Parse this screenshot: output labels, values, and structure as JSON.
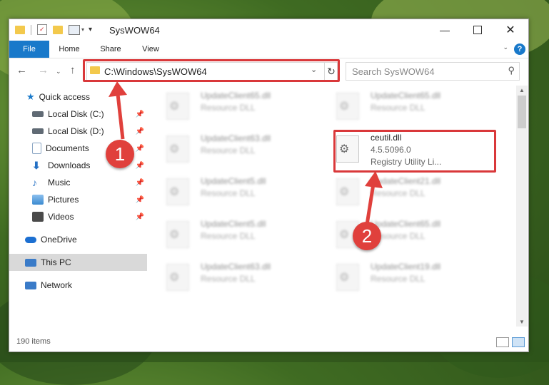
{
  "window": {
    "title": "SysWOW64"
  },
  "ribbon": {
    "tabs": [
      "File",
      "Home",
      "Share",
      "View"
    ],
    "help": "?"
  },
  "address": {
    "path": "C:\\Windows\\SysWOW64"
  },
  "search": {
    "placeholder": "Search SysWOW64"
  },
  "sidebar": {
    "items": [
      {
        "label": "Quick access",
        "icon": "star-icon",
        "color": "#1979ca"
      },
      {
        "label": "Local Disk (C:)",
        "icon": "drive-icon",
        "color": "#606a74",
        "pinned": true
      },
      {
        "label": "Local Disk (D:)",
        "icon": "drive-icon",
        "color": "#606a74",
        "pinned": true
      },
      {
        "label": "Documents",
        "icon": "document-icon",
        "color": "#8ba6c4",
        "pinned": true
      },
      {
        "label": "Downloads",
        "icon": "download-icon",
        "color": "#2470c4",
        "pinned": true
      },
      {
        "label": "Music",
        "icon": "music-icon",
        "color": "#2470c4",
        "pinned": true
      },
      {
        "label": "Pictures",
        "icon": "pictures-icon",
        "color": "#3b8ad0",
        "pinned": true
      },
      {
        "label": "Videos",
        "icon": "video-icon",
        "color": "#4a4a4a",
        "pinned": true
      },
      {
        "label": "OneDrive",
        "icon": "cloud-icon",
        "color": "#1c6fd1"
      },
      {
        "label": "This PC",
        "icon": "computer-icon",
        "color": "#3a7bc8",
        "selected": true
      },
      {
        "label": "Network",
        "icon": "network-icon",
        "color": "#3a7bc8"
      }
    ]
  },
  "files": [
    {
      "name": "UpdateClient65.dll",
      "sub": "Resource DLL",
      "blurred": true
    },
    {
      "name": "UpdateClient65.dll",
      "sub": "Resource DLL",
      "blurred": true
    },
    {
      "name": "UpdateClient63.dll",
      "sub": "Resource DLL",
      "blurred": true
    },
    {
      "name": "ceutil.dll",
      "version": "4.5.5096.0",
      "sub": "Registry Utility Li...",
      "blurred": false
    },
    {
      "name": "UpdateClient5.dll",
      "sub": "Resource DLL",
      "blurred": true
    },
    {
      "name": "UpdateClient21.dll",
      "sub": "Resource DLL",
      "blurred": true
    },
    {
      "name": "UpdateClient5.dll",
      "sub": "Resource DLL",
      "blurred": true
    },
    {
      "name": "UpdateClient65.dll",
      "sub": "Resource DLL",
      "blurred": true
    },
    {
      "name": "UpdateClient63.dll",
      "sub": "Resource DLL",
      "blurred": true
    },
    {
      "name": "UpdateClient19.dll",
      "sub": "Resource DLL",
      "blurred": true
    }
  ],
  "status": {
    "count": "190 items"
  },
  "annotations": {
    "step1": "1",
    "step2": "2",
    "color": "#e0403c"
  }
}
